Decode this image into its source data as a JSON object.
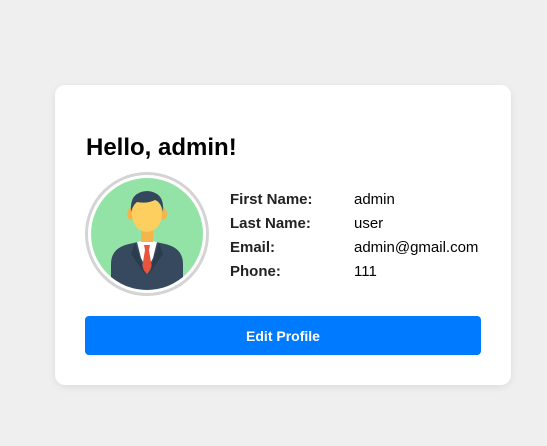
{
  "profile": {
    "greeting": "Hello, admin!",
    "avatar_icon": "user-avatar-icon",
    "fields": [
      {
        "label": "First Name:",
        "value": "admin"
      },
      {
        "label": "Last Name:",
        "value": "user"
      },
      {
        "label": "Email:",
        "value": "admin@gmail.com"
      },
      {
        "label": "Phone:",
        "value": "111"
      }
    ],
    "edit_button_label": "Edit Profile"
  },
  "colors": {
    "page_background": "#efefef",
    "card_background": "#ffffff",
    "button_background": "#007bff",
    "avatar_background": "#93e3a6"
  }
}
